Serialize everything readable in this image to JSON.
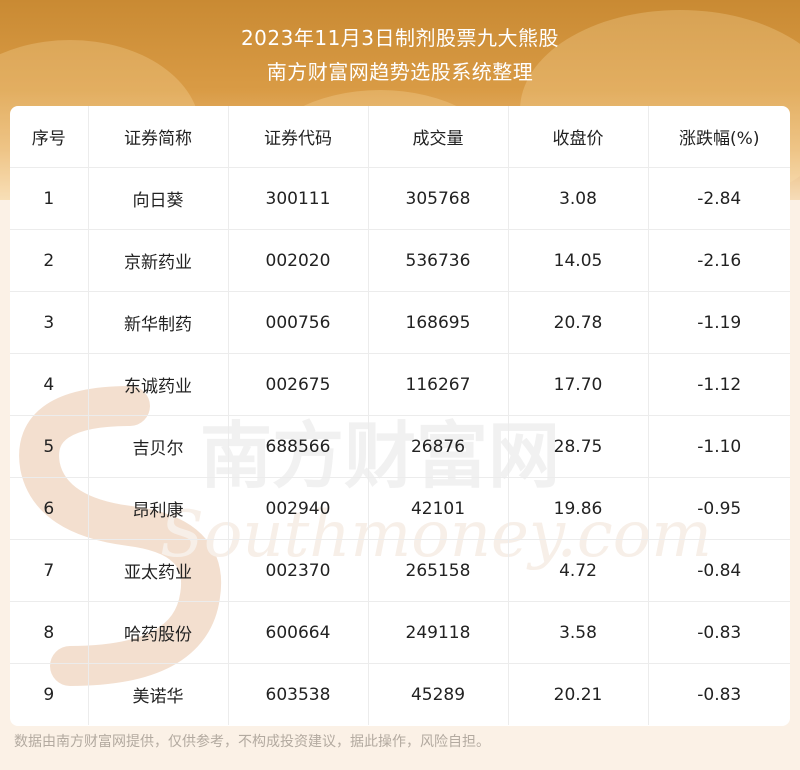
{
  "header": {
    "title_line1": "2023年11月3日制剂股票九大熊股",
    "title_line2": "南方财富网趋势选股系统整理"
  },
  "table": {
    "columns": [
      "序号",
      "证券简称",
      "证券代码",
      "成交量",
      "收盘价",
      "涨跌幅(%)"
    ],
    "rows": [
      [
        "1",
        "向日葵",
        "300111",
        "305768",
        "3.08",
        "-2.84"
      ],
      [
        "2",
        "京新药业",
        "002020",
        "536736",
        "14.05",
        "-2.16"
      ],
      [
        "3",
        "新华制药",
        "000756",
        "168695",
        "20.78",
        "-1.19"
      ],
      [
        "4",
        "东诚药业",
        "002675",
        "116267",
        "17.70",
        "-1.12"
      ],
      [
        "5",
        "吉贝尔",
        "688566",
        "26876",
        "28.75",
        "-1.10"
      ],
      [
        "6",
        "昂利康",
        "002940",
        "42101",
        "19.86",
        "-0.95"
      ],
      [
        "7",
        "亚太药业",
        "002370",
        "265158",
        "4.72",
        "-0.84"
      ],
      [
        "8",
        "哈药股份",
        "600664",
        "249118",
        "3.58",
        "-0.83"
      ],
      [
        "9",
        "美诺华",
        "603538",
        "45289",
        "20.21",
        "-0.83"
      ]
    ]
  },
  "watermark": {
    "cn_text": "南方财富网",
    "en_text": "Southmoney.com"
  },
  "footer": {
    "disclaimer": "数据由南方财富网提供，仅供参考，不构成投资建议，据此操作，风险自担。"
  }
}
